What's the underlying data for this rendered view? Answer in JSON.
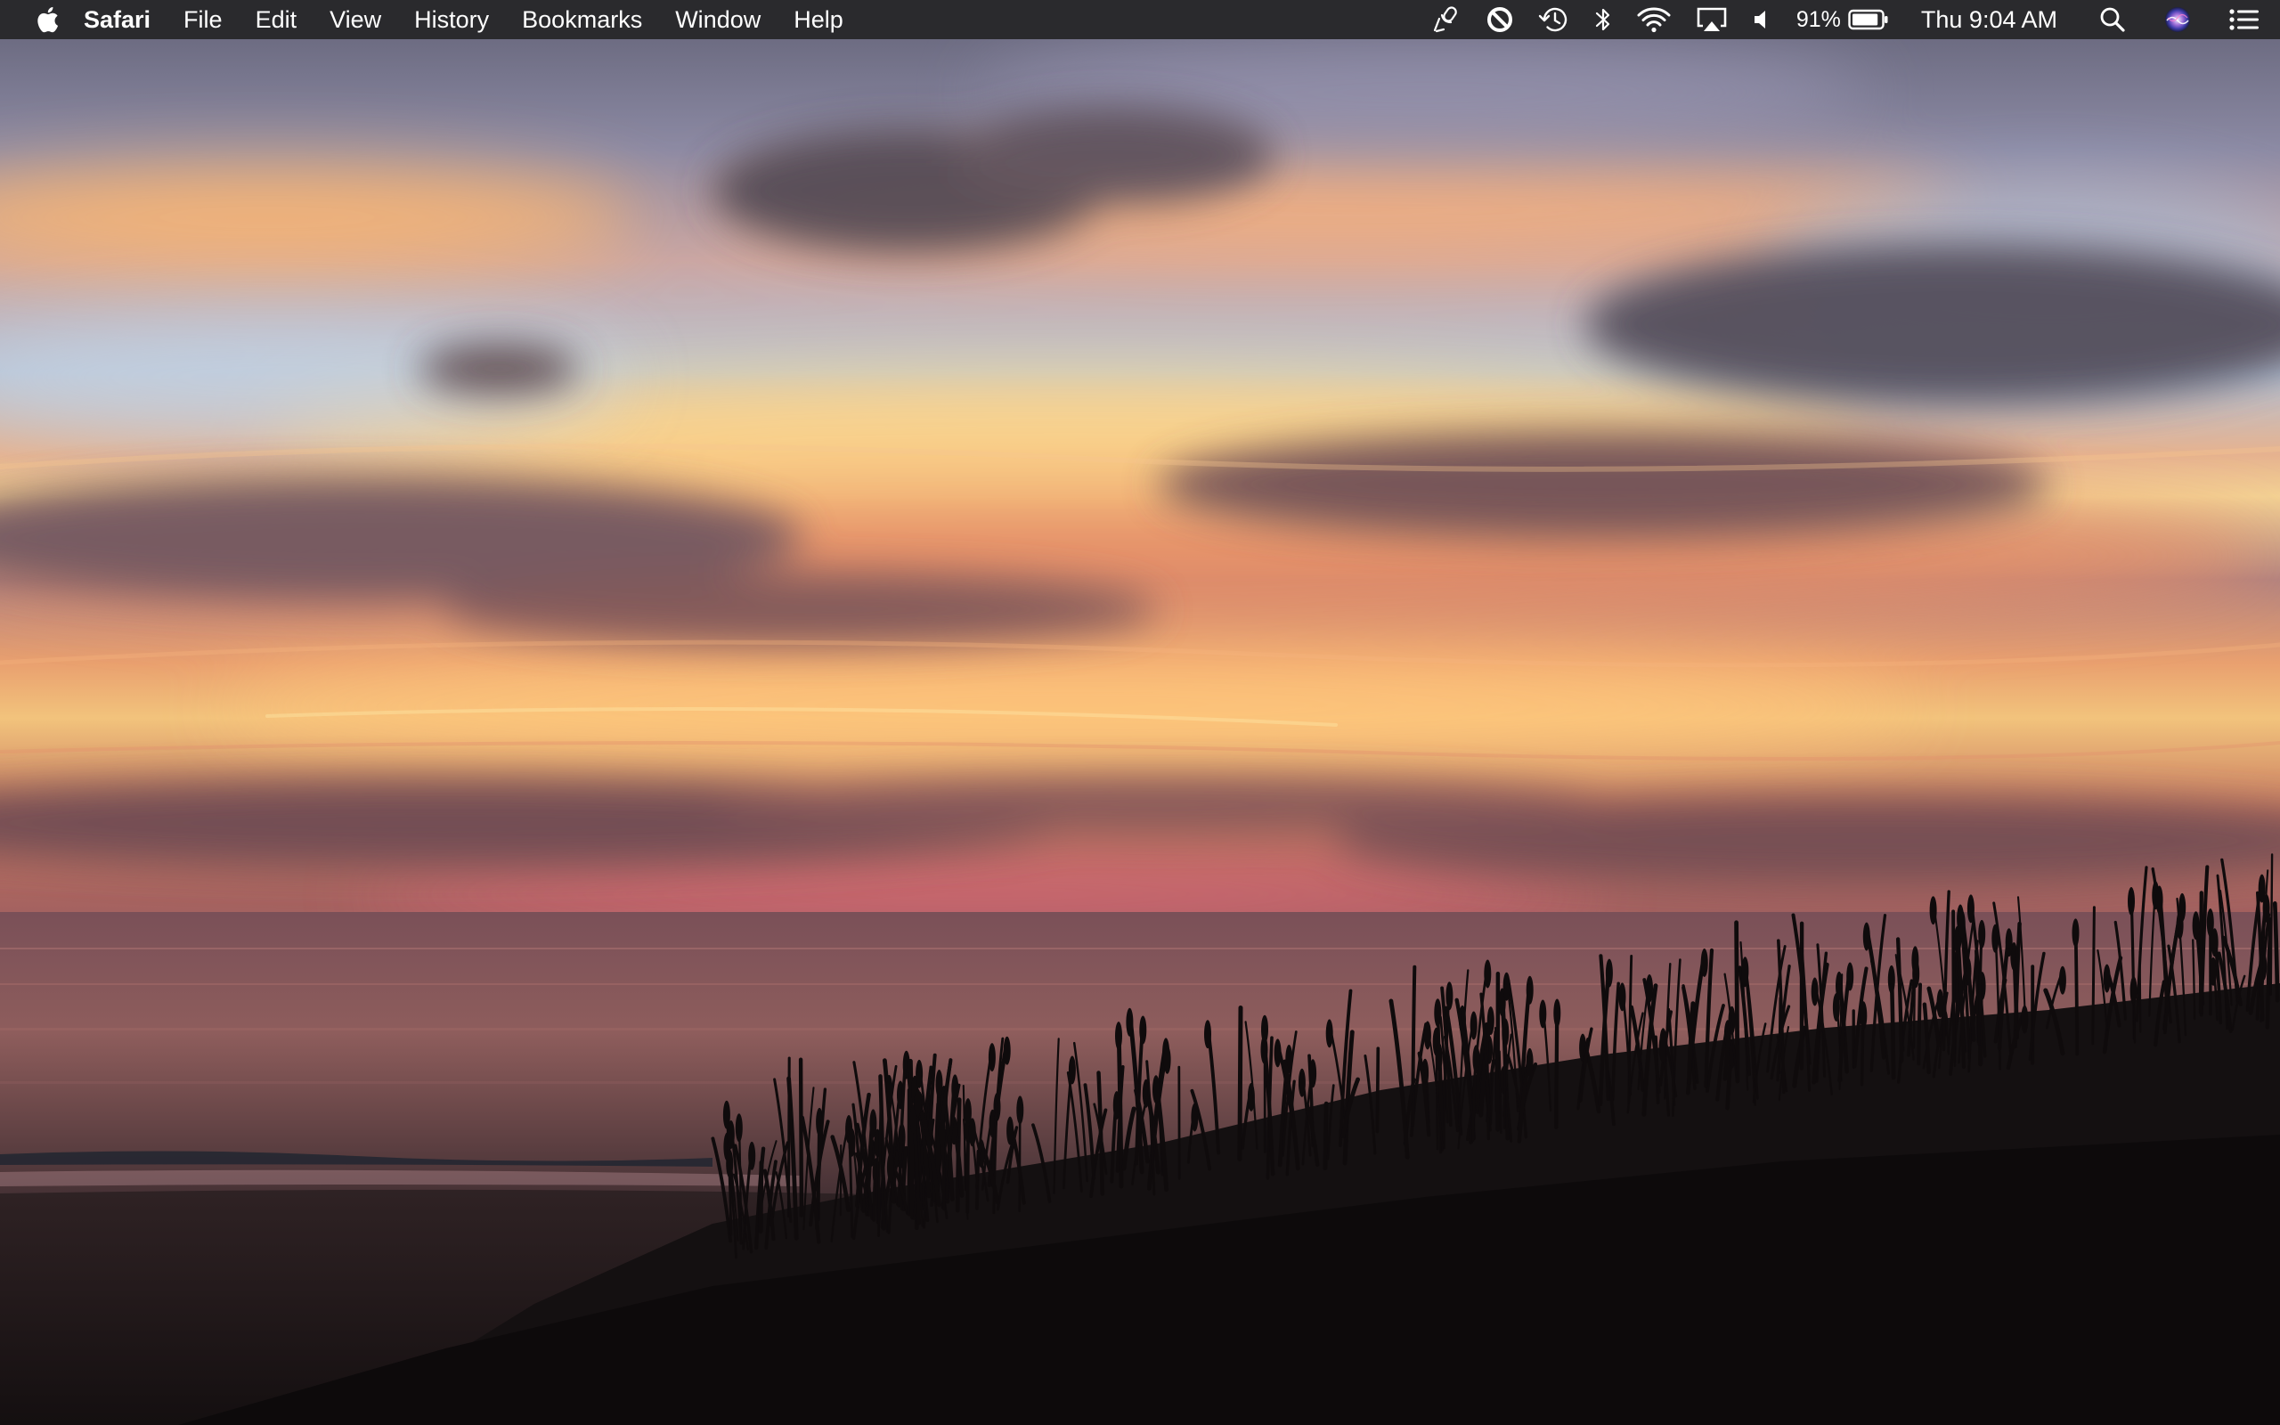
{
  "menubar": {
    "app_name": "Safari",
    "menus": [
      "File",
      "Edit",
      "View",
      "History",
      "Bookmarks",
      "Window",
      "Help"
    ],
    "status": {
      "battery_percent": "91%",
      "battery_level": 0.91,
      "clock": "Thu 9:04 AM"
    },
    "icons": [
      "apple-icon",
      "microphone-icon",
      "do-not-disturb-icon",
      "time-machine-icon",
      "bluetooth-icon",
      "wifi-icon",
      "airplay-icon",
      "volume-icon",
      "battery-icon",
      "spotlight-search-icon",
      "siri-icon",
      "notification-center-icon"
    ]
  },
  "desktop": {
    "wallpaper": "sunset-over-ocean-with-dune-grass",
    "colors": {
      "menubar_bg": "#2a2a2d",
      "sky_orange": "#f0a065",
      "sky_blue": "#b6c2d4",
      "horizon_pink": "#d06a70",
      "dune_silhouette": "#121010"
    }
  }
}
